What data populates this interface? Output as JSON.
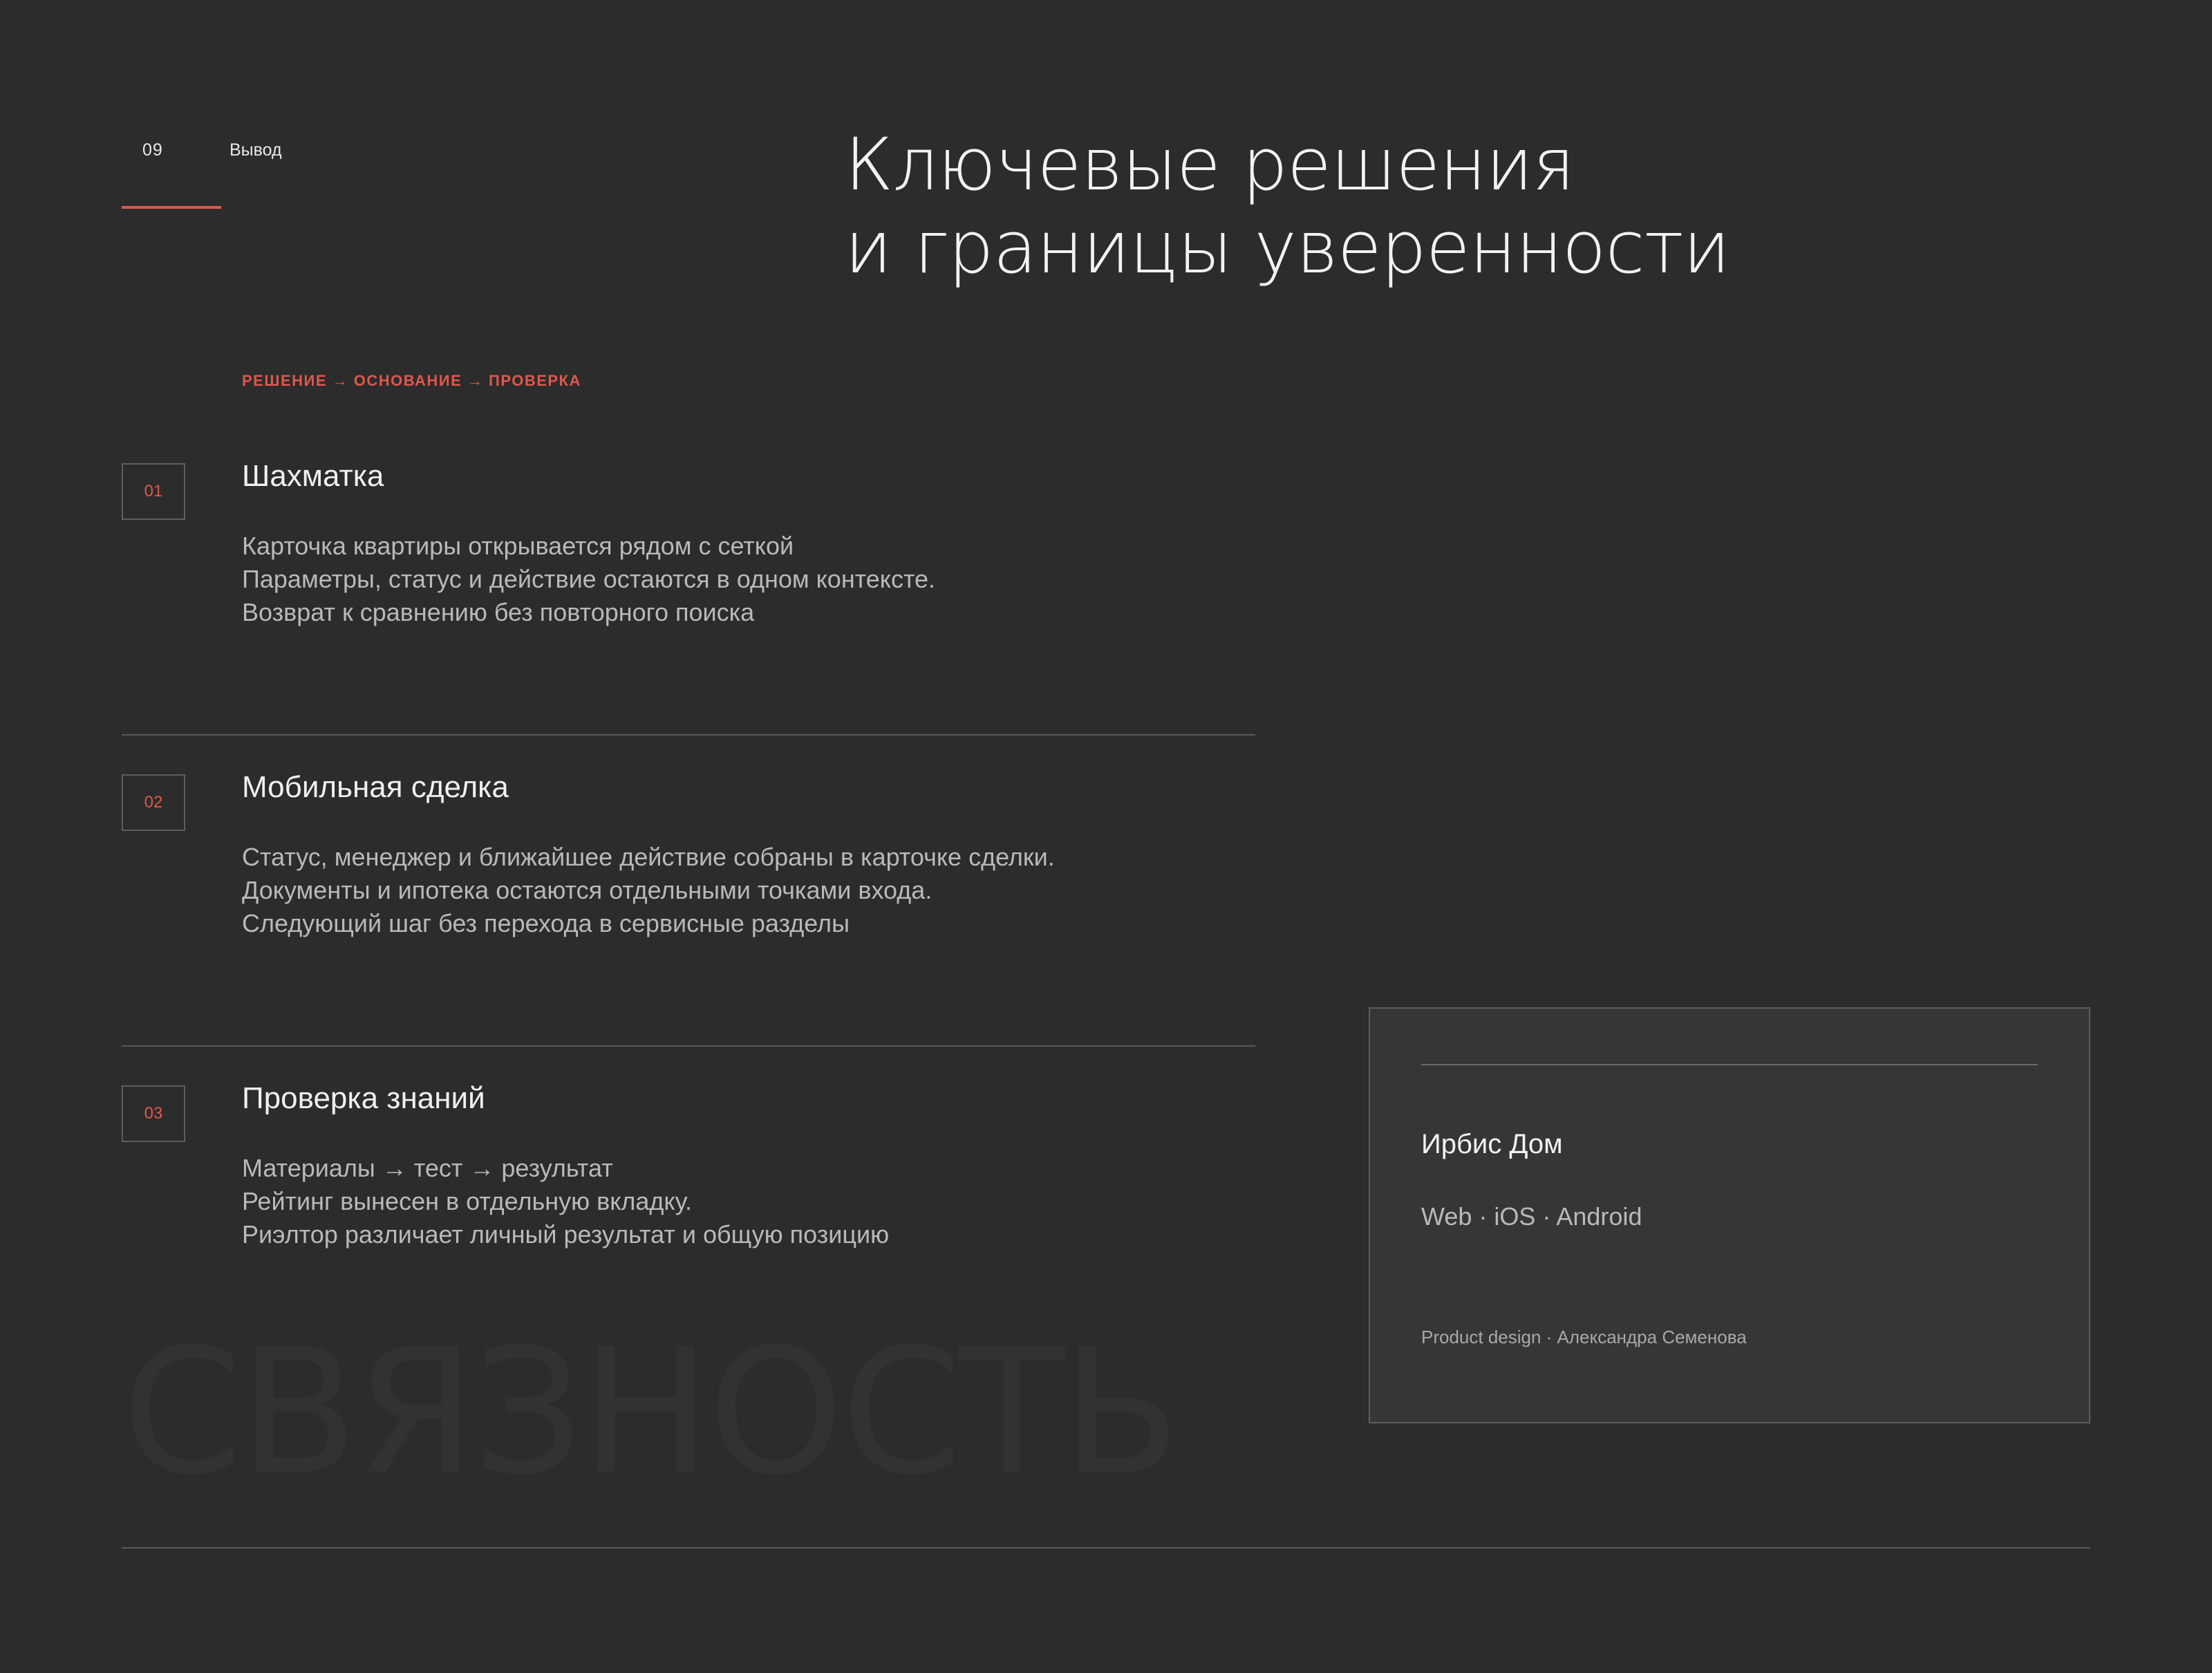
{
  "section": {
    "number": "09",
    "label": "Вывод"
  },
  "title": {
    "line1": "Ключевые решения",
    "line2": "и границы уверенности"
  },
  "flow_label": "РЕШЕНИЕ → ОСНОВАНИЕ → ПРОВЕРКА",
  "items": [
    {
      "number": "01",
      "title": "Шахматка",
      "lines": [
        "Карточка квартиры открывается рядом с сеткой",
        "Параметры, статус и действие остаются в одном контексте.",
        "Возврат к сравнению без повторного поиска"
      ]
    },
    {
      "number": "02",
      "title": "Мобильная сделка",
      "lines": [
        "Статус, менеджер и ближайшее действие собраны в карточке сделки.",
        "Документы и ипотека остаются отдельными точками входа.",
        "Следующий шаг без перехода в сервисные разделы"
      ]
    },
    {
      "number": "03",
      "title": "Проверка знаний",
      "lines": [
        "Материалы → тест → результат",
        "Рейтинг вынесен в отдельную вкладку.",
        "Риэлтор различает личный результат и общую позицию"
      ]
    }
  ],
  "watermark": "СВЯЗНОСТЬ",
  "card": {
    "title": "Ирбис Дом",
    "platforms": "Web · iOS · Android",
    "credit": "Product design · Александра Семенова"
  },
  "colors": {
    "background": "#2c2c2c",
    "accent": "#e0574c",
    "card_background": "#353736"
  }
}
